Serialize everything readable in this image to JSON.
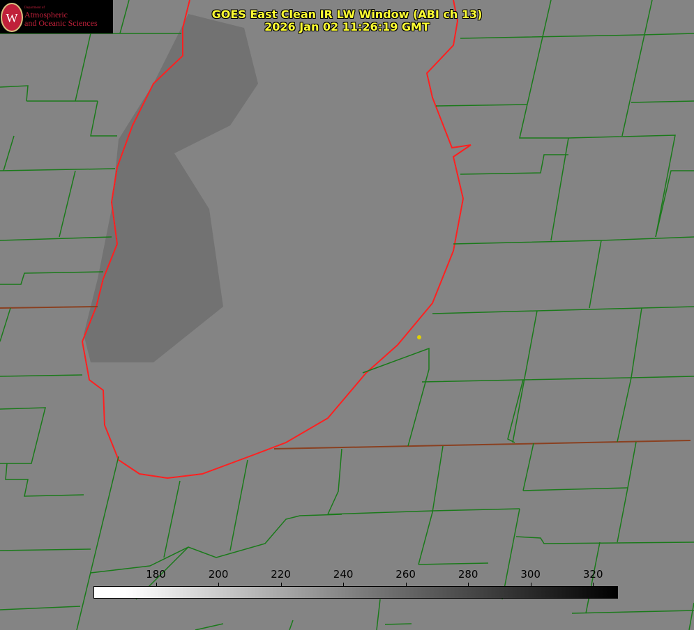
{
  "header": {
    "title_line1": "GOES East Clean IR LW Window (ABI ch 13)",
    "title_line2": "2026 Jan 02 11:26:19 GMT"
  },
  "logo": {
    "dept": "Department of",
    "line1": "Atmospheric",
    "line2": "and Oceanic Sciences",
    "shield_letter": "W"
  },
  "colorbar": {
    "ticks": [
      "180",
      "200",
      "220",
      "240",
      "260",
      "280",
      "300",
      "320"
    ],
    "range_note_colors": {
      "low": "#ffffff",
      "high": "#000000"
    }
  },
  "colors": {
    "background": "#848484",
    "county_lines": "#1a7a1a",
    "coastline": "#ff1a1a",
    "title_text": "#ffff33"
  }
}
